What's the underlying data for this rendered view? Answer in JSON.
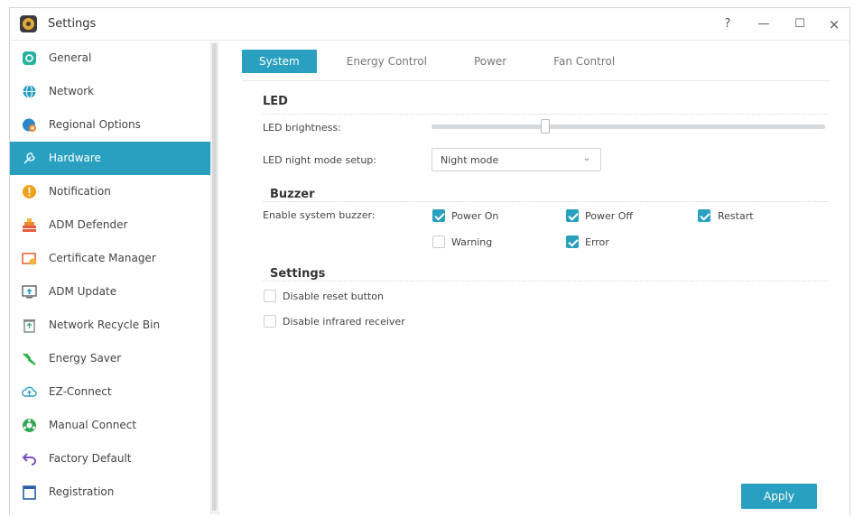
{
  "window": {
    "title": "Settings",
    "controls": {
      "help": "?",
      "minimize": "—",
      "maximize": "☐",
      "close": "×"
    }
  },
  "sidebar": {
    "items": [
      {
        "label": "General",
        "icon": "general-icon",
        "color": "#27b3a0"
      },
      {
        "label": "Network",
        "icon": "globe-icon",
        "color": "#2aa0c1"
      },
      {
        "label": "Regional Options",
        "icon": "regional-icon",
        "color": "#2a86c9"
      },
      {
        "label": "Hardware",
        "icon": "hardware-icon",
        "color": "#ffffff"
      },
      {
        "label": "Notification",
        "icon": "notification-icon",
        "color": "#f0a21a"
      },
      {
        "label": "ADM Defender",
        "icon": "defender-icon",
        "color": "#e55b3c"
      },
      {
        "label": "Certificate Manager",
        "icon": "certificate-icon",
        "color": "#e8663a"
      },
      {
        "label": "ADM Update",
        "icon": "update-icon",
        "color": "#5f6b75"
      },
      {
        "label": "Network Recycle Bin",
        "icon": "recycle-bin-icon",
        "color": "#7a8a84"
      },
      {
        "label": "Energy Saver",
        "icon": "energy-saver-icon",
        "color": "#2fb34e"
      },
      {
        "label": "EZ-Connect",
        "icon": "cloud-connect-icon",
        "color": "#2aa0c1"
      },
      {
        "label": "Manual Connect",
        "icon": "manual-connect-icon",
        "color": "#33a852"
      },
      {
        "label": "Factory Default",
        "icon": "undo-icon",
        "color": "#7a4fbf"
      },
      {
        "label": "Registration",
        "icon": "registration-icon",
        "color": "#2a5ea8"
      }
    ],
    "active_index": 3
  },
  "tabs": [
    {
      "label": "System",
      "active": true
    },
    {
      "label": "Energy Control",
      "active": false
    },
    {
      "label": "Power",
      "active": false
    },
    {
      "label": "Fan Control",
      "active": false
    }
  ],
  "led": {
    "title": "LED",
    "brightness_label": "LED brightness:",
    "brightness_level": 0.29,
    "night_mode_label": "LED night mode setup:",
    "night_mode_value": "Night mode"
  },
  "buzzer": {
    "title": "Buzzer",
    "enable_label": "Enable system buzzer:",
    "options": [
      {
        "label": "Power On",
        "checked": true
      },
      {
        "label": "Power Off",
        "checked": true
      },
      {
        "label": "Restart",
        "checked": true
      },
      {
        "label": "Warning",
        "checked": false
      },
      {
        "label": "Error",
        "checked": true
      }
    ]
  },
  "settings": {
    "title": "Settings",
    "options": [
      {
        "label": "Disable reset button",
        "checked": false
      },
      {
        "label": "Disable infrared receiver",
        "checked": false
      }
    ]
  },
  "apply_label": "Apply",
  "colors": {
    "accent": "#2aa0c1"
  }
}
